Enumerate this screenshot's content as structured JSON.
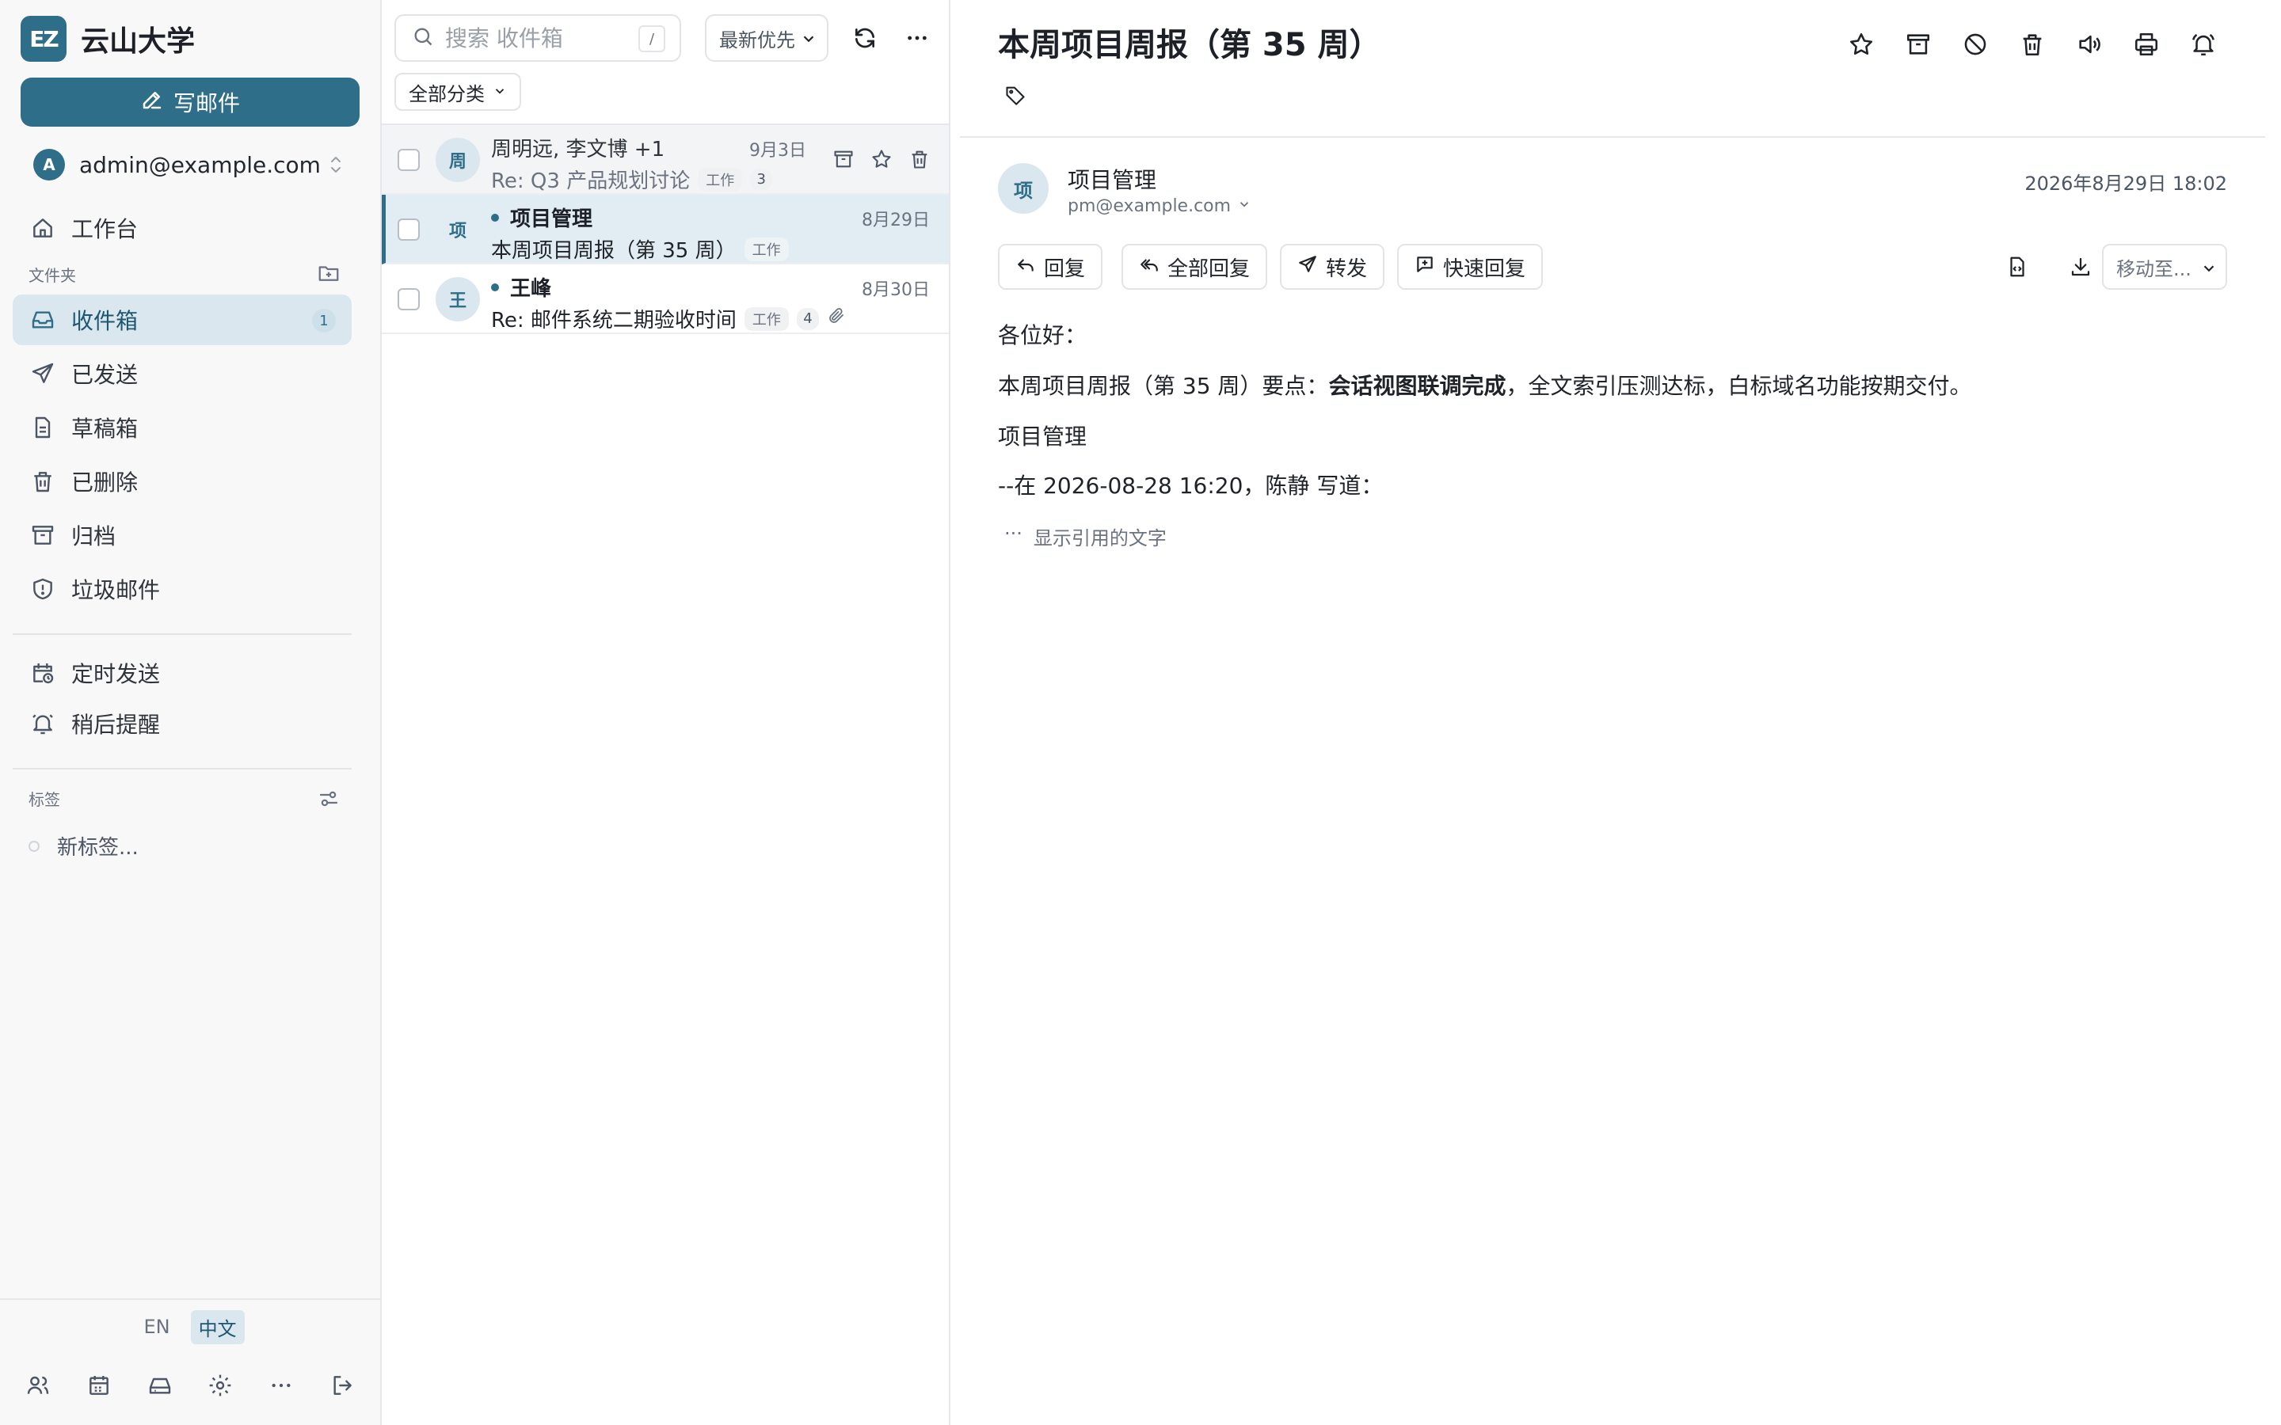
{
  "brand": {
    "logo_text": "EZ",
    "name": "云山大学"
  },
  "sidebar": {
    "compose_label": "写邮件",
    "account": {
      "initial": "A",
      "email": "admin@example.com"
    },
    "workbench_label": "工作台",
    "folders_label": "文件夹",
    "folders": [
      {
        "label": "收件箱",
        "badge": "1"
      },
      {
        "label": "已发送"
      },
      {
        "label": "草稿箱"
      },
      {
        "label": "已删除"
      },
      {
        "label": "归档"
      },
      {
        "label": "垃圾邮件"
      }
    ],
    "extras": [
      {
        "label": "定时发送"
      },
      {
        "label": "稍后提醒"
      }
    ],
    "tags_label": "标签",
    "new_tag_label": "新标签...",
    "languages": [
      {
        "label": "EN"
      },
      {
        "label": "中文",
        "active": true
      }
    ]
  },
  "list": {
    "search_placeholder": "搜索 收件箱",
    "search_shortcut": "/",
    "sort_value": "最新优先",
    "category_filter": "全部分类",
    "messages": [
      {
        "avatar": "周",
        "sender": "周明远, 李文博 +1",
        "date": "9月3日",
        "subject": "Re: Q3 产品规划讨论",
        "tag": "工作",
        "count": "3",
        "unread": false
      },
      {
        "avatar": "项",
        "sender": "项目管理",
        "date": "8月29日",
        "subject": "本周项目周报（第 35 周）",
        "tag": "工作",
        "unread": true
      },
      {
        "avatar": "王",
        "sender": "王峰",
        "date": "8月30日",
        "subject": "Re: 邮件系统二期验收时间",
        "tag": "工作",
        "count": "4",
        "unread": true,
        "attachment": true
      }
    ]
  },
  "reader": {
    "title": "本周项目周报（第 35 周）",
    "from": {
      "avatar": "项",
      "name": "项目管理",
      "email": "pm@example.com"
    },
    "date": "2026年8月29日 18:02",
    "actions": {
      "reply": "回复",
      "reply_all": "全部回复",
      "forward": "转发",
      "quick_reply": "快速回复"
    },
    "move_to": "移动至...",
    "body": {
      "greeting": "各位好：",
      "line_prefix": "本周项目周报（第 35 周）要点：",
      "line_bold": "会话视图联调完成",
      "line_suffix": "，全文索引压测达标，白标域名功能按期交付。",
      "signature": "项目管理",
      "quote_header": "--在 2026-08-28 16:20，陈静 写道：",
      "show_quote_ellipsis": "···",
      "show_quote": "显示引用的文字"
    }
  },
  "colors": {
    "accent": "#2e6e89",
    "selected_row": "#e2edf3",
    "sidebar_bg": "#f8f8f9"
  }
}
